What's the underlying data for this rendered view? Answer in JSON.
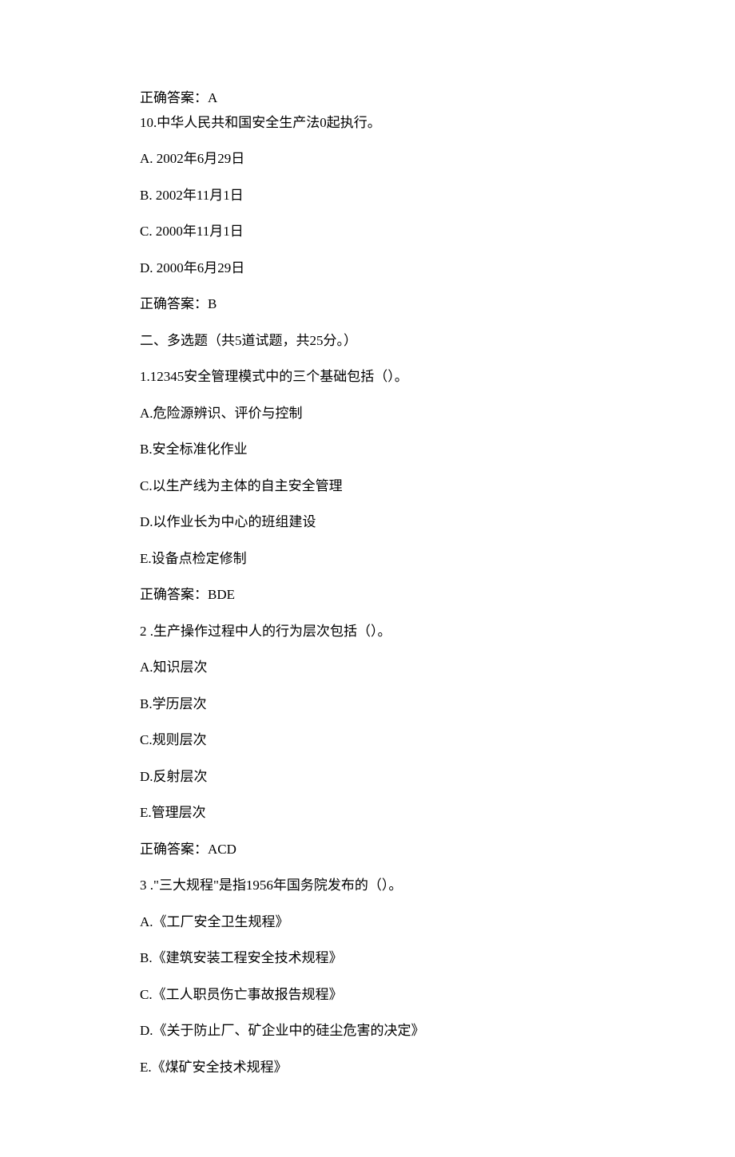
{
  "q9_answer_label": "正确答案：A",
  "q10": {
    "stem": "10.中华人民共和国安全生产法0起执行。",
    "options": [
      "A.  2002年6月29日",
      "B.  2002年11月1日",
      "C.  2000年11月1日",
      "D.  2000年6月29日"
    ],
    "answer": "正确答案：B"
  },
  "section2": "二、多选题（共5道试题，共25分。）",
  "m1": {
    "stem": "1.12345安全管理模式中的三个基础包括（）。",
    "options": [
      "A.危险源辨识、评价与控制",
      "B.安全标准化作业",
      "C.以生产线为主体的自主安全管理",
      "D.以作业长为中心的班组建设",
      "E.设备点检定修制"
    ],
    "answer": "正确答案：BDE"
  },
  "m2": {
    "stem": "2 .生产操作过程中人的行为层次包括（）。",
    "options": [
      "A.知识层次",
      "B.学历层次",
      "C.规则层次",
      "D.反射层次",
      "E.管理层次"
    ],
    "answer": "正确答案：ACD"
  },
  "m3": {
    "stem": "3 .\"三大规程\"是指1956年国务院发布的（）。",
    "options": [
      "A.《工厂安全卫生规程》",
      "B.《建筑安装工程安全技术规程》",
      "C.《工人职员伤亡事故报告规程》",
      "D.《关于防止厂、矿企业中的硅尘危害的决定》",
      "E.《煤矿安全技术规程》"
    ]
  }
}
